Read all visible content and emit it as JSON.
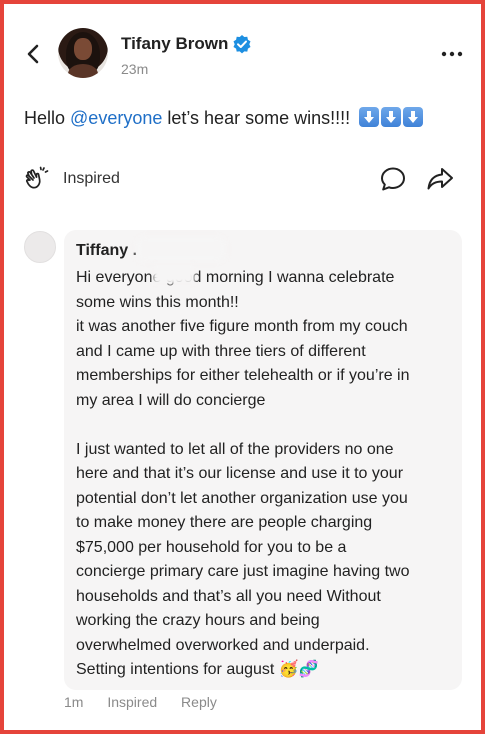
{
  "post": {
    "author": "Tifany Brown",
    "time": "23m",
    "text_prefix": "Hello ",
    "mention": "@everyone",
    "text_suffix": " let’s hear some wins!!!!",
    "reaction_label": "Inspired"
  },
  "comment": {
    "name": "Tiffany .",
    "body": "Hi everyone good morning I wanna celebrate\nsome wins this month!!\nit was another five figure month from my couch\nand I came up with three tiers of different\nmemberships for either telehealth or if you’re in\nmy area I will do concierge\n\nI just wanted to let all of the providers no one\nhere and that it’s our license and use it to your\npotential don’t let another organization use you\nto make money there are people charging\n$75,000 per household for you to be a\nconcierge primary care just imagine having two\nhouseholds and that’s all you need Without\nworking the crazy hours and being\noverwhelmed overworked and underpaid.\nSetting intentions for august 🥳🧬",
    "time": "1m",
    "inspired_label": "Inspired",
    "reply_label": "Reply"
  },
  "icons": {
    "back": "chevron-left-icon",
    "verified": "verified-badge-icon",
    "more": "more-horizontal-icon",
    "clap": "clapping-hands-icon",
    "comment": "comment-bubble-icon",
    "share": "share-arrow-icon",
    "down_arrow": "down-arrow-emoji-icon"
  },
  "colors": {
    "border": "#e5443a",
    "mention": "#1f6fc7",
    "verified": "#1d8fe1",
    "bubble": "#f6f5f5"
  }
}
